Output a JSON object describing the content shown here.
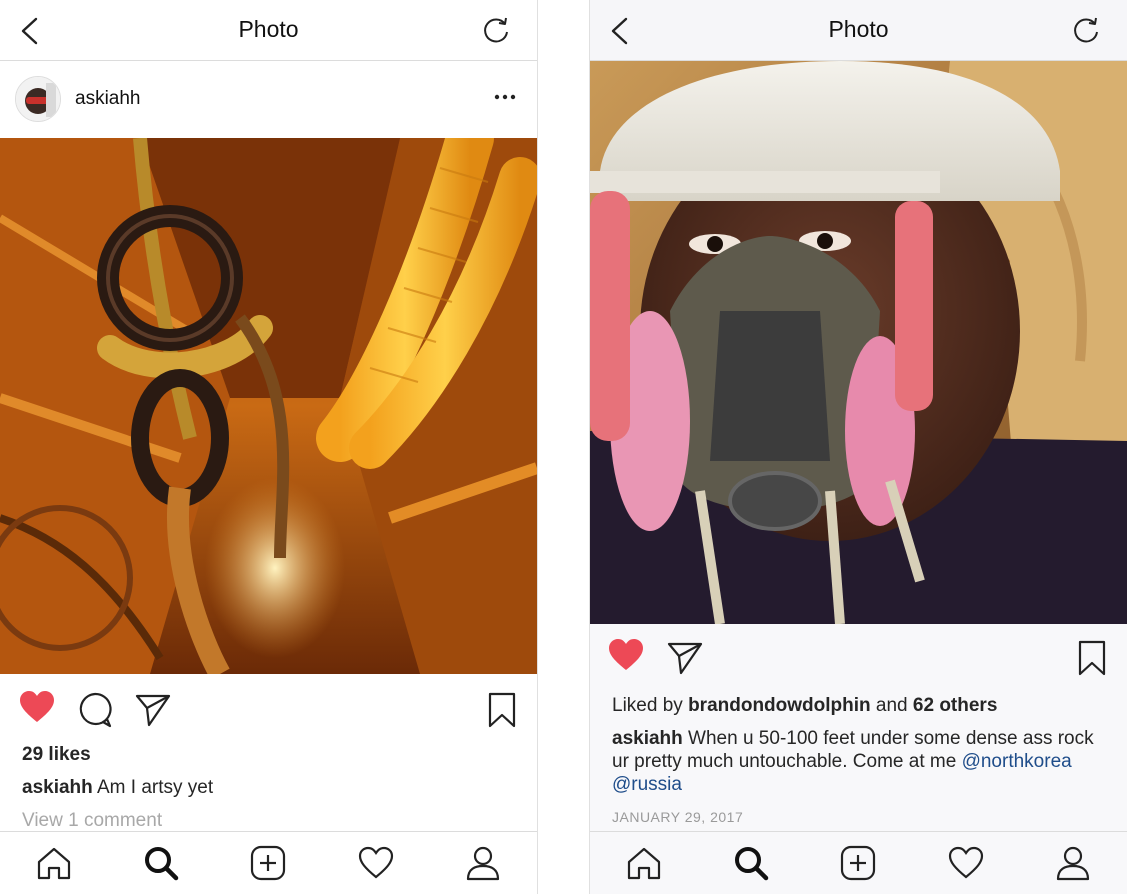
{
  "left": {
    "header_title": "Photo",
    "username": "askiahh",
    "likes": "29 likes",
    "caption_user": "askiahh",
    "caption_text": "Am I artsy yet",
    "comments_link": "View 1 comment"
  },
  "right": {
    "header_title": "Photo",
    "liked_by_prefix": "Liked by",
    "liked_by_user": "brandondowdolphin",
    "liked_by_and": "and",
    "liked_by_others": "62 others",
    "caption_user": "askiahh",
    "caption_text": "When u 50-100 feet under some dense ass rock ur pretty much untouchable. Come at me",
    "mention_1": "@northkorea",
    "mention_2": "@russia",
    "date": "JANUARY 29, 2017"
  },
  "icons": [
    "back-icon",
    "refresh-icon",
    "more-icon",
    "heart-filled-icon",
    "comment-icon",
    "share-icon",
    "bookmark-icon",
    "home-icon",
    "search-icon",
    "add-icon",
    "activity-heart-icon",
    "profile-icon"
  ],
  "colors": {
    "like_red": "#ed4956",
    "text": "#262626",
    "muted": "#a8a8a8",
    "mention_blue": "#1f4d8a"
  }
}
